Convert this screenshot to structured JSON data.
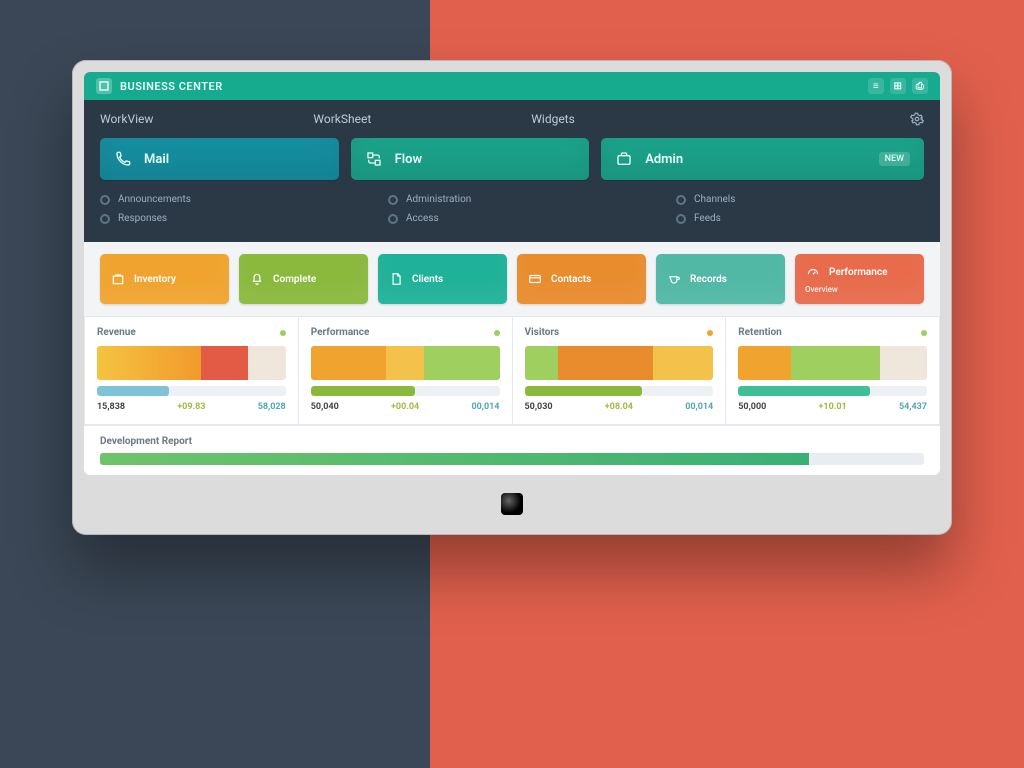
{
  "topbar": {
    "title": "BUSINESS CENTER",
    "actions": {
      "a": "≡",
      "b": "⊞",
      "c": "⎙"
    }
  },
  "tabs": {
    "t1": "WorkView",
    "t2": "WorkSheet",
    "t3": "Widgets"
  },
  "bigButtons": {
    "b1": {
      "label": "Mail"
    },
    "b2": {
      "label": "Flow"
    },
    "b3": {
      "label": "Admin",
      "badge": "NEW"
    }
  },
  "radios": {
    "col1": {
      "r1": "Announcements",
      "r2": "Responses"
    },
    "col2": {
      "r1": "Administration",
      "r2": "Access"
    },
    "col3": {
      "r1": "Channels",
      "r2": "Feeds"
    }
  },
  "cards": {
    "c1": {
      "label": "Inventory"
    },
    "c2": {
      "label": "Complete"
    },
    "c3": {
      "label": "Clients"
    },
    "c4": {
      "label": "Contacts"
    },
    "c5": {
      "label": "Records",
      "sub": ""
    },
    "c6": {
      "label": "Performance",
      "sub": "Overview"
    }
  },
  "stats": {
    "s1": {
      "title": "Revenue",
      "v1": "15,838",
      "v2": "+09.83",
      "v3": "58,028"
    },
    "s2": {
      "title": "Performance",
      "v1": "50,040",
      "v2": "+00.04",
      "v3": "00,014"
    },
    "s3": {
      "title": "Visitors",
      "v1": "50,030",
      "v2": "+08.04",
      "v3": "00,014"
    },
    "s4": {
      "title": "Retention",
      "v1": "50,000",
      "v2": "+10.01",
      "v3": "54,437"
    }
  },
  "footer": {
    "label": "Development Report"
  },
  "colors": {
    "orange": "#f0a42f",
    "green": "#8ab93e",
    "teal": "#1fb199",
    "aqua": "#51b8a5",
    "coral": "#e86b4c",
    "red": "#e35b45",
    "dkorange": "#e98c2e"
  },
  "chart_data": [
    {
      "type": "bar",
      "title": "Revenue",
      "series": [
        {
          "name": "a",
          "values": [
            55
          ]
        },
        {
          "name": "b",
          "values": [
            25
          ]
        },
        {
          "name": "c",
          "values": [
            20
          ]
        }
      ],
      "mini": 38
    },
    {
      "type": "bar",
      "title": "Performance",
      "series": [
        {
          "name": "a",
          "values": [
            40
          ]
        },
        {
          "name": "b",
          "values": [
            20
          ]
        },
        {
          "name": "c",
          "values": [
            40
          ]
        }
      ],
      "mini": 55
    },
    {
      "type": "bar",
      "title": "Visitors",
      "series": [
        {
          "name": "a",
          "values": [
            18
          ]
        },
        {
          "name": "b",
          "values": [
            50
          ]
        },
        {
          "name": "c",
          "values": [
            32
          ]
        }
      ],
      "mini": 62
    },
    {
      "type": "bar",
      "title": "Retention",
      "series": [
        {
          "name": "a",
          "values": [
            28
          ]
        },
        {
          "name": "b",
          "values": [
            47
          ]
        },
        {
          "name": "c",
          "values": [
            25
          ]
        }
      ],
      "mini": 70
    }
  ]
}
